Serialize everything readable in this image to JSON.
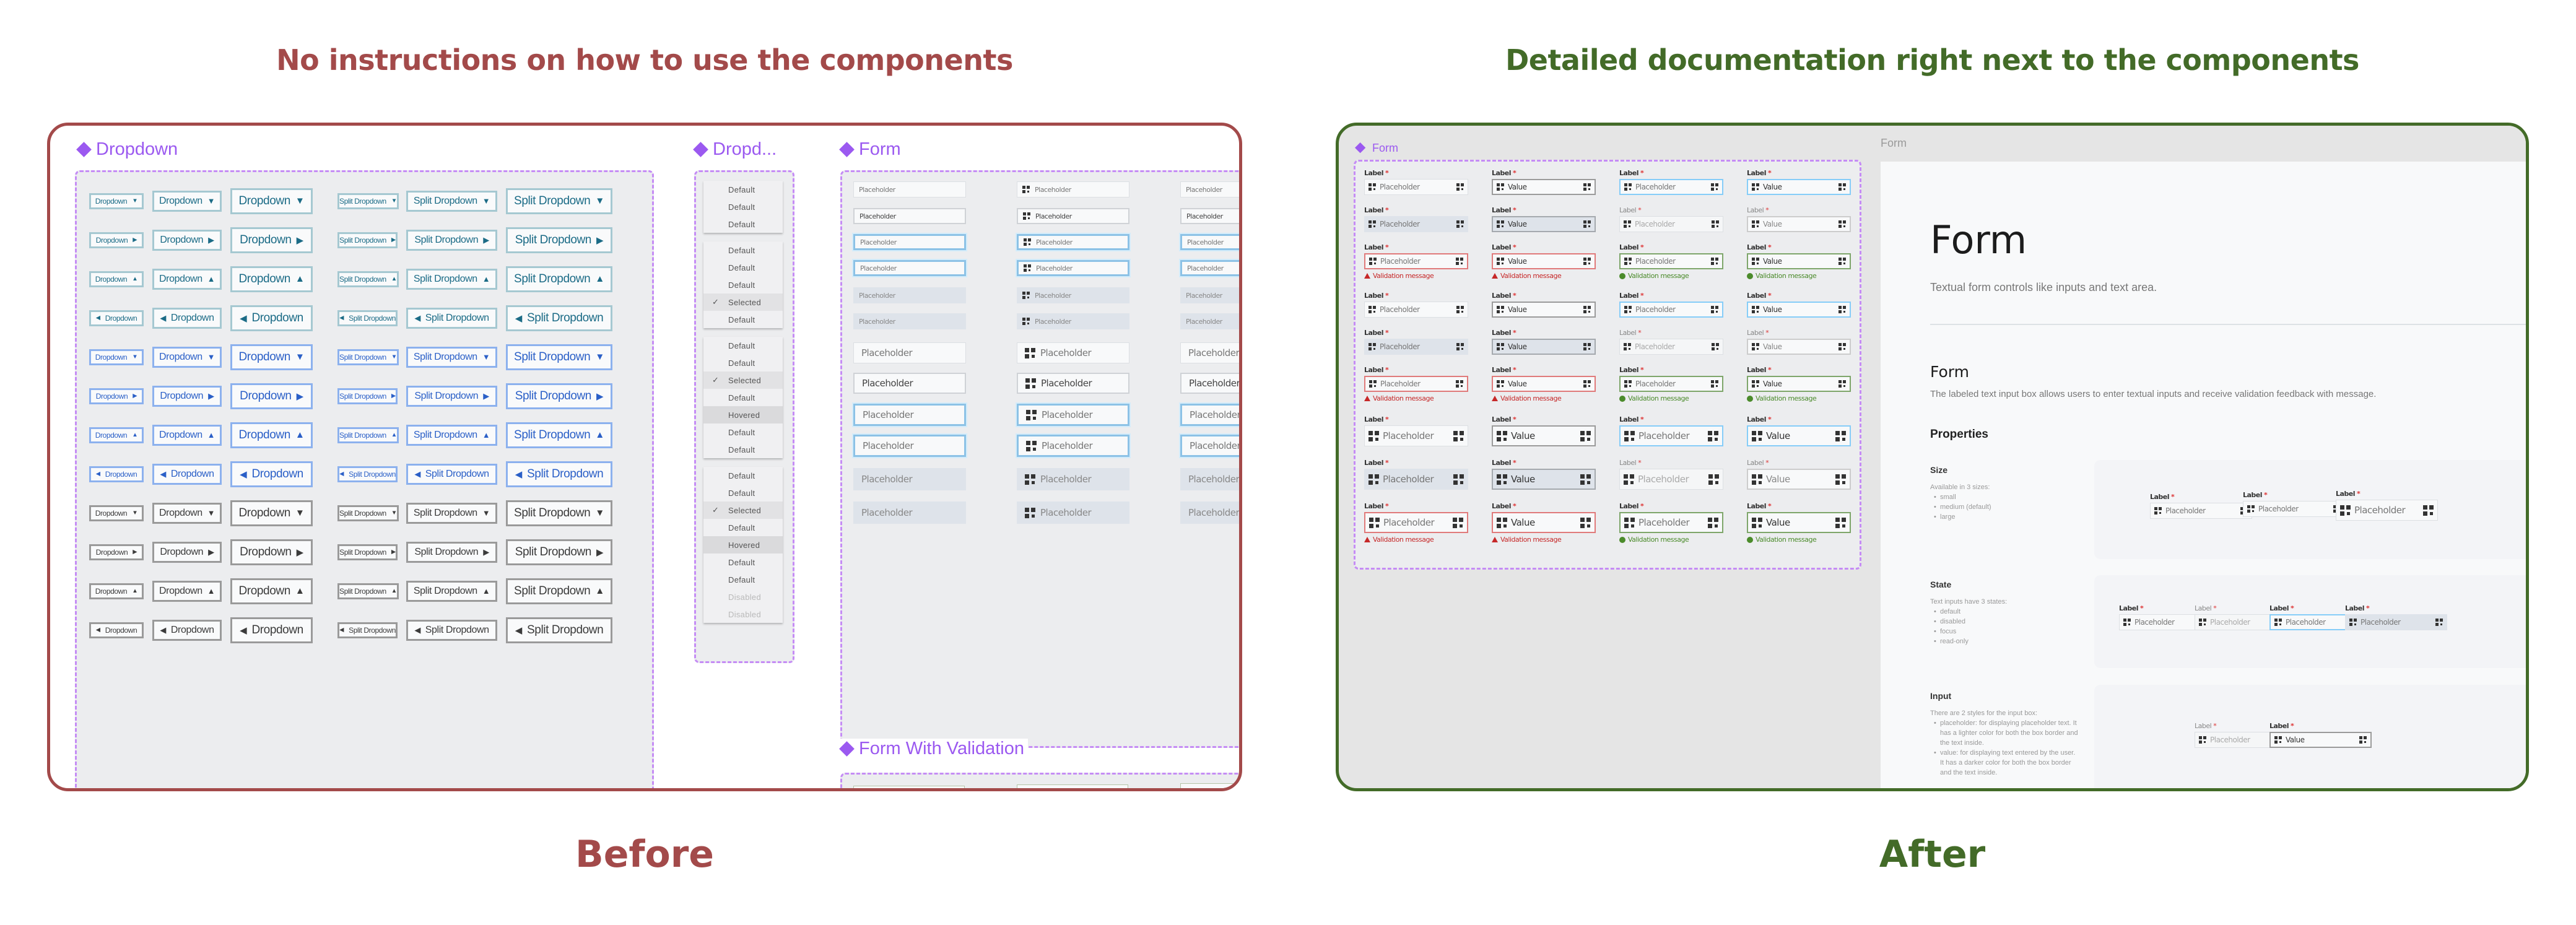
{
  "captions": {
    "before_heading": "No instructions on how to use the components",
    "after_heading": "Detailed documentation right next to the components",
    "before_label": "Before",
    "after_label": "After"
  },
  "colors": {
    "before": "#a34a4a",
    "after": "#436b28",
    "frame_accent": "#9b59f0",
    "error": "#c62828",
    "success": "#4b8b2b",
    "focus": "#86cdf8"
  },
  "before": {
    "dropdown_frame": {
      "title": "Dropdown",
      "variants": [
        "teal",
        "blue",
        "gray"
      ],
      "arrows": [
        "▼",
        "▶",
        "▲",
        "◀"
      ],
      "button_label": "Dropdown",
      "split_label": "Split Dropdown"
    },
    "menu_frame": {
      "title": "Dropd...",
      "menus": [
        [
          {
            "label": "Default"
          },
          {
            "label": "Default"
          },
          {
            "label": "Default"
          }
        ],
        [
          {
            "label": "Default"
          },
          {
            "label": "Default"
          },
          {
            "label": "Default"
          },
          {
            "label": "Selected",
            "state": "selected"
          },
          {
            "label": "Default"
          }
        ],
        [
          {
            "label": "Default"
          },
          {
            "label": "Default"
          },
          {
            "label": "Selected",
            "state": "selected"
          },
          {
            "label": "Default"
          },
          {
            "label": "Hovered",
            "state": "hovered"
          },
          {
            "label": "Default"
          },
          {
            "label": "Default"
          }
        ],
        [
          {
            "label": "Default"
          },
          {
            "label": "Default"
          },
          {
            "label": "Selected",
            "state": "selected"
          },
          {
            "label": "Default"
          },
          {
            "label": "Hovered",
            "state": "hovered"
          },
          {
            "label": "Default"
          },
          {
            "label": "Default"
          },
          {
            "label": "Disabled",
            "state": "disabled"
          },
          {
            "label": "Disabled",
            "state": "disabled"
          }
        ]
      ],
      "check_glyph": "✓"
    },
    "form_frame": {
      "title": "Form",
      "placeholder": "Placeholder",
      "row_states": [
        "default",
        "value",
        "focus",
        "focus",
        "disabled",
        "disabled",
        "default",
        "value",
        "focus",
        "focus",
        "disabled",
        "disabled"
      ]
    },
    "validation_frame": {
      "title": "Form With Validation"
    }
  },
  "after": {
    "frame_title": "Form",
    "label": "Label",
    "required_mark": "*",
    "placeholder": "Placeholder",
    "value": "Value",
    "validation_message": "Validation message",
    "grid_rows": [
      {
        "states": [
          "default",
          "value",
          "focus",
          "focusv"
        ],
        "size": "small"
      },
      {
        "states": [
          "disabled",
          "disabledv",
          "readonly",
          "readonlyv"
        ],
        "size": "small"
      },
      {
        "states": [
          "error",
          "errorv",
          "success",
          "successv"
        ],
        "size": "small"
      },
      {
        "states": [
          "default",
          "value",
          "focus",
          "focusv"
        ],
        "size": "small"
      },
      {
        "states": [
          "disabled",
          "disabledv",
          "readonly",
          "readonlyv"
        ],
        "size": "small"
      },
      {
        "states": [
          "error",
          "errorv",
          "success",
          "successv"
        ],
        "size": "small"
      },
      {
        "states": [
          "default",
          "value",
          "focus",
          "focusv"
        ],
        "size": "large"
      },
      {
        "states": [
          "disabled",
          "disabledv",
          "readonly",
          "readonlyv"
        ],
        "size": "large"
      },
      {
        "states": [
          "error",
          "errorv",
          "success",
          "successv"
        ],
        "size": "large"
      }
    ],
    "doc": {
      "breadcrumb": "Form",
      "title": "Form",
      "subtitle": "Textual form controls like inputs and text area.",
      "section_title": "Form",
      "section_desc": "The labeled text input box allows users to enter textual inputs and receive validation feedback with message.",
      "properties_title": "Properties",
      "properties": [
        {
          "name": "Size",
          "intro": "Available in 3 sizes:",
          "items": [
            "small",
            "medium (default)",
            "large"
          ]
        },
        {
          "name": "State",
          "intro": "Text inputs have 3 states:",
          "items": [
            "default",
            "disabled",
            "focus",
            "read-only"
          ]
        },
        {
          "name": "Input",
          "intro": "There are 2 styles for the input box:",
          "items": [
            "placeholder: for displaying placeholder text. It has a lighter color for both the box border and the text inside.",
            "value: for displaying text entered by the user. It has a darker color for both the box border and the text inside."
          ]
        }
      ]
    }
  }
}
